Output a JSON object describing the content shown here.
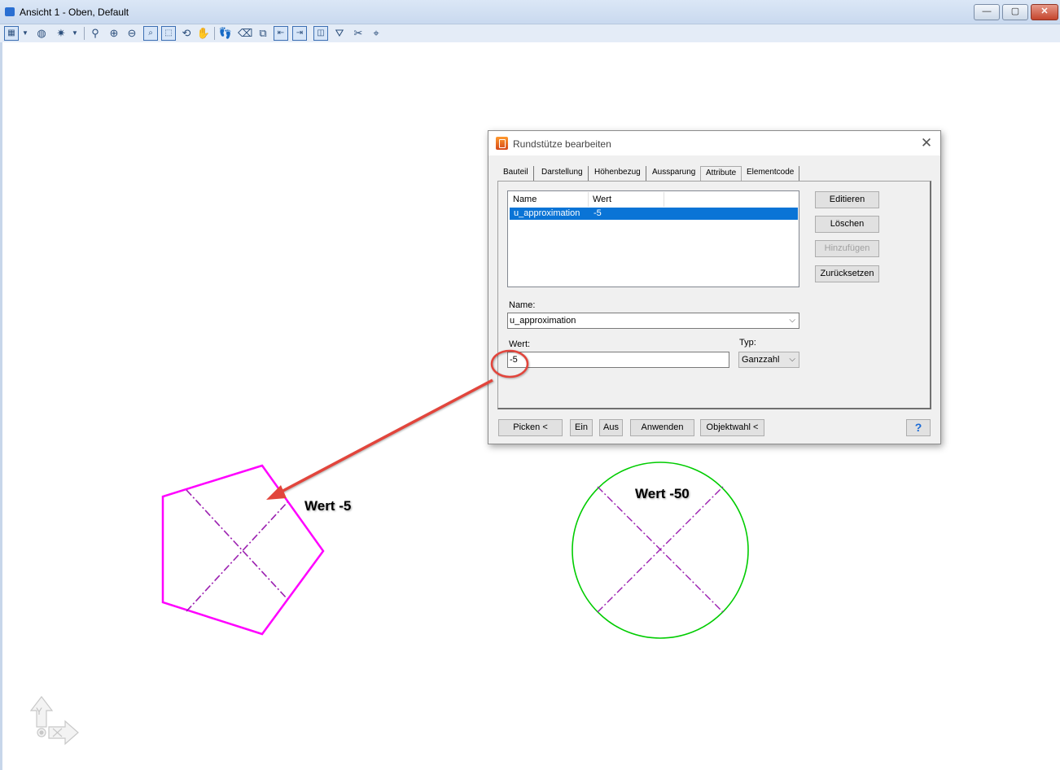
{
  "window": {
    "title": "Ansicht 1 - Oben, Default",
    "controls": {
      "minimize": "—",
      "maximize": "▢",
      "close": "✕"
    }
  },
  "toolbar": {
    "icons": [
      "view-icon",
      "dropdown-icon",
      "globe-icon",
      "light-icon",
      "dropdown-icon",
      "brush-icon",
      "zoom-in-icon",
      "zoom-out-icon",
      "zoom-window-icon",
      "fit-view-icon",
      "rotate-view-icon",
      "pan-hand-icon",
      "walk-icon",
      "eraser-icon",
      "copy-view-icon",
      "previous-view-icon",
      "next-view-icon",
      "split-view-icon",
      "clip-volume-icon",
      "clip-mask-icon",
      "camera-icon"
    ]
  },
  "dialog": {
    "title": "Rundstütze bearbeiten",
    "close": "✕",
    "tabs": [
      "Bauteil",
      "Darstellung",
      "Höhenbezug",
      "Aussparung",
      "Attribute",
      "Elementcode"
    ],
    "active_tab": "Attribute",
    "list": {
      "columns": [
        "Name",
        "Wert"
      ],
      "rows": [
        {
          "name": "u_approximation",
          "value": "-5"
        }
      ]
    },
    "side_buttons": {
      "edit": "Editieren",
      "delete": "Löschen",
      "add": "Hinzufügen",
      "reset": "Zurücksetzen"
    },
    "name_label": "Name:",
    "name_value": "u_approximation",
    "wert_label": "Wert:",
    "wert_value": "-5",
    "typ_label": "Typ:",
    "typ_value": "Ganzzahl",
    "bottom_buttons": {
      "pick": "Picken <",
      "on": "Ein",
      "off": "Aus",
      "apply": "Anwenden",
      "object_select": "Objektwahl <",
      "help": "?"
    }
  },
  "drawing": {
    "label_pentagon": "Wert -5",
    "label_circle": "Wert -50",
    "axis_y": "Y",
    "colors": {
      "pentagon": "#ff00ff",
      "circle": "#00cc00",
      "centerlines": "#9b1fb0",
      "annotation": "#e2453c",
      "selection": "#0a74d6"
    }
  }
}
